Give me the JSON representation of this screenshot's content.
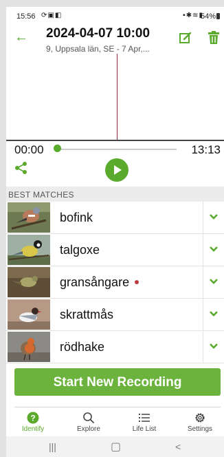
{
  "status_bar": {
    "time": "15:56",
    "left_icons": [
      "sync-icon",
      "cast-icon",
      "notification-icon"
    ],
    "right_icons": [
      "lock-icon",
      "bluetooth-icon",
      "wifi-icon",
      "signal-icon"
    ],
    "battery": "54%"
  },
  "header": {
    "title": "2024-04-07 10:00",
    "subtitle": "9, Uppsala län, SE - 7 Apr,..."
  },
  "player": {
    "current_time": "00:00",
    "total_time": "13:13",
    "progress": 0.0
  },
  "best_matches": {
    "heading": "BEST MATCHES",
    "items": [
      {
        "name": "bofink",
        "flagged": false
      },
      {
        "name": "talgoxe",
        "flagged": false
      },
      {
        "name": "gransångare",
        "flagged": true
      },
      {
        "name": "skrattmås",
        "flagged": false
      },
      {
        "name": "rödhake",
        "flagged": false
      }
    ]
  },
  "start_button": {
    "label": "Start New Recording"
  },
  "bottom_nav": {
    "items": [
      {
        "label": "Identify",
        "icon": "question-circle-icon",
        "active": true
      },
      {
        "label": "Explore",
        "icon": "search-icon",
        "active": false
      },
      {
        "label": "Life List",
        "icon": "list-icon",
        "active": false
      },
      {
        "label": "Settings",
        "icon": "gear-icon",
        "active": false
      }
    ]
  },
  "colors": {
    "accent": "#5aaa2e",
    "button": "#6cb33e",
    "playhead": "#8b2a3a",
    "flag_dot": "#c0393b"
  }
}
